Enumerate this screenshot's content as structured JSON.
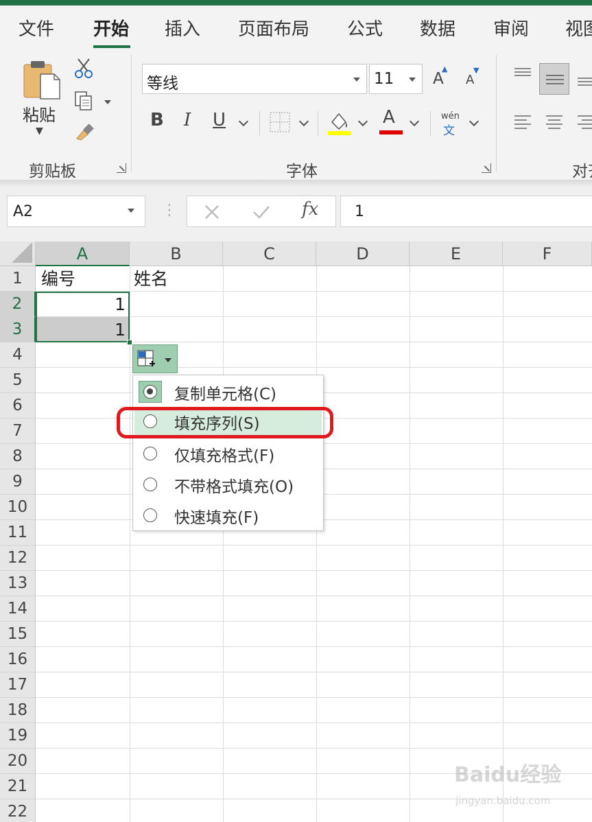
{
  "ribbon_tabs": [
    "文件",
    "开始",
    "插入",
    "页面布局",
    "公式",
    "数据",
    "审阅",
    "视图"
  ],
  "clipboard": {
    "paste_label": "粘贴",
    "group_label": "剪贴板"
  },
  "font": {
    "name": "等线",
    "size": "11",
    "group_label": "字体",
    "bold": "B",
    "italic": "I",
    "underline": "U",
    "font_color_letter": "A",
    "grow_letter": "A",
    "shrink_letter": "A",
    "phonetic_top": "wén",
    "phonetic_bottom": "文",
    "highlight_color": "#ffff00",
    "font_color": "#e00000"
  },
  "alignment": {
    "group_label": "对齐"
  },
  "formula_bar": {
    "name_box": "A2",
    "fx_label": "fx",
    "value": "1"
  },
  "columns": [
    "A",
    "B",
    "C",
    "D",
    "E",
    "F"
  ],
  "rows": [
    "1",
    "2",
    "3",
    "4",
    "5",
    "6",
    "7",
    "8",
    "9",
    "10",
    "11",
    "12",
    "13",
    "14",
    "15",
    "16",
    "17",
    "18",
    "19",
    "20",
    "21",
    "22"
  ],
  "cells": {
    "A1": "编号",
    "B1": "姓名",
    "A2": "1",
    "A3": "1"
  },
  "autofill_menu": {
    "items": [
      "复制单元格(C)",
      "填充序列(S)",
      "仅填充格式(F)",
      "不带格式填充(O)",
      "快速填充(F)"
    ],
    "selected_index": 0,
    "highlighted_index": 1
  },
  "watermark": {
    "main": "Baidu经验",
    "sub": "jingyan.baidu.com"
  },
  "colors": {
    "accent": "#217346",
    "annotation": "#e0191f"
  }
}
